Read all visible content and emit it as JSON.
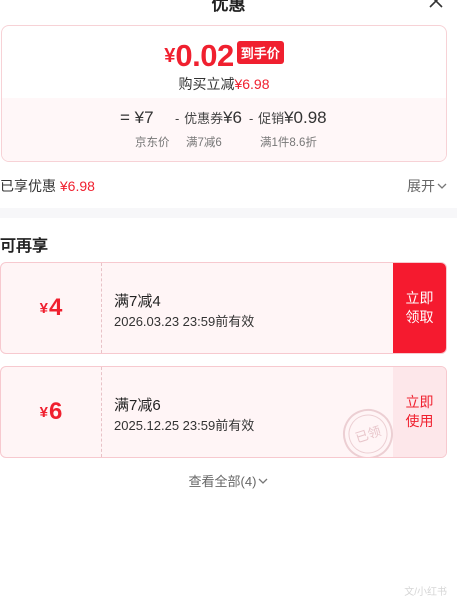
{
  "header": {
    "title": "优惠"
  },
  "price": {
    "currency": "¥",
    "amount": "0.02",
    "tag": "到手价",
    "subtitle_prefix": "购买立减",
    "subtitle_value": "¥6.98"
  },
  "breakdown": [
    {
      "symbol": "=",
      "label": "",
      "value": "¥7",
      "caption": "京东价"
    },
    {
      "symbol": "-",
      "label": "优惠券",
      "value": "¥6",
      "caption": "满7减6"
    },
    {
      "symbol": "-",
      "label": "促销",
      "value": "¥0.98",
      "caption": "满1件8.6折"
    }
  ],
  "enjoyed": {
    "label": "已享优惠",
    "value": "¥6.98"
  },
  "expand_label": "展开",
  "section_title": "可再享",
  "coupons": [
    {
      "currency": "¥",
      "amount": "4",
      "name": "满7减4",
      "validity": "2026.03.23 23:59前有效",
      "action": "立即领取",
      "action_lines": [
        "立即",
        "领取"
      ],
      "stamp": ""
    },
    {
      "currency": "¥",
      "amount": "6",
      "name": "满7减6",
      "validity": "2025.12.25 23:59前有效",
      "action": "立即使用",
      "action_lines": [
        "立即",
        "使用"
      ],
      "stamp": "已领"
    }
  ],
  "view_all": "查看全部(4)",
  "watermark": "文/小红书",
  "colors": {
    "accent": "#f0202f",
    "coupon_bg": "#fff5f6",
    "coupon_border": "#f7c9cf"
  },
  "icons": {
    "close": "close-icon",
    "expand": "chevron-down-icon",
    "view_all": "chevron-down-icon"
  }
}
